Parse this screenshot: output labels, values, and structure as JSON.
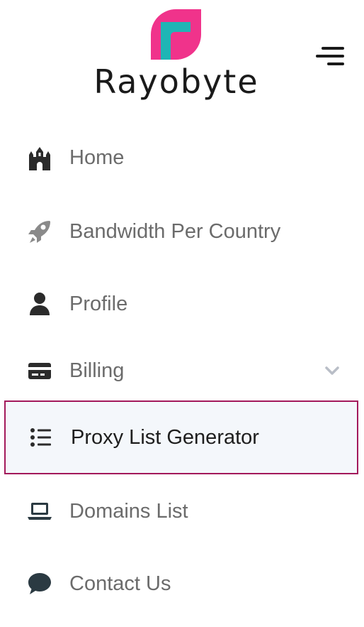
{
  "brand": {
    "name": "Rayobyte",
    "logo_icon": "rayobyte-logo-icon",
    "colors": {
      "pink": "#f0338b",
      "teal": "#1fb5b5"
    }
  },
  "menu_toggle": {
    "icon": "hamburger-menu-icon"
  },
  "nav": {
    "items": [
      {
        "label": "Home",
        "icon": "castle-icon"
      },
      {
        "label": "Bandwidth Per Country",
        "icon": "rocket-icon"
      },
      {
        "label": "Profile",
        "icon": "user-icon"
      },
      {
        "label": "Billing",
        "icon": "credit-card-icon",
        "expand_icon": "chevron-down-icon"
      },
      {
        "label": "Proxy List Generator",
        "icon": "list-icon",
        "active": true
      },
      {
        "label": "Domains List",
        "icon": "laptop-icon"
      },
      {
        "label": "Contact Us",
        "icon": "chat-bubble-icon"
      }
    ],
    "active_border_color": "#a3195b",
    "active_background": "#f4f7fb"
  }
}
